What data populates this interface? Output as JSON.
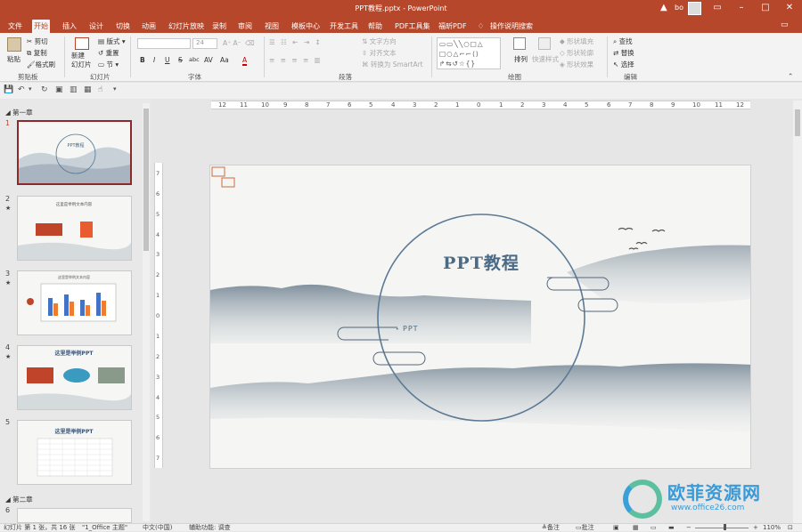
{
  "window": {
    "title": "PPT教程.pptx  -  PowerPoint",
    "user": "bo"
  },
  "tabs": [
    "文件",
    "开始",
    "插入",
    "设计",
    "切换",
    "动画",
    "幻灯片放映",
    "录制",
    "审阅",
    "视图",
    "模板中心",
    "开发工具",
    "帮助",
    "PDF工具集",
    "福昕PDF",
    "操作说明搜索"
  ],
  "active_tab": "开始",
  "ribbon": {
    "clipboard": {
      "paste": "粘贴",
      "cut": "剪切",
      "copy": "复制",
      "format_painter": "格式刷",
      "label": "剪贴板"
    },
    "slides": {
      "new_slide": "新建\n幻灯片",
      "layout": "版式",
      "reset": "重置",
      "section": "节",
      "label": "幻灯片"
    },
    "font": {
      "font_name": "",
      "font_size": "24",
      "label": "字体",
      "buttons": [
        "B",
        "I",
        "U",
        "S",
        "abc",
        "AV",
        "Aa",
        "A"
      ]
    },
    "paragraph": {
      "text_direction": "文字方向",
      "align_text": "对齐文本",
      "smartart": "转换为 SmartArt",
      "label": "段落"
    },
    "drawing": {
      "arrange": "排列",
      "quick_styles": "快速样式",
      "shape_fill": "形状填充",
      "shape_outline": "形状轮廓",
      "shape_effects": "形状效果",
      "label": "绘图"
    },
    "editing": {
      "find": "查找",
      "replace": "替换",
      "select": "选择",
      "label": "编辑"
    }
  },
  "sections": [
    "第一章",
    "第二章"
  ],
  "thumbnails": [
    {
      "num": "1",
      "title": "PPT教程"
    },
    {
      "num": "2",
      "title": "这里是举例文本内容"
    },
    {
      "num": "3",
      "title": "这里是举例文本内容"
    },
    {
      "num": "4",
      "title": "这里是举例PPT"
    },
    {
      "num": "5",
      "title": "这里是举例PPT"
    },
    {
      "num": "6",
      "title": ""
    }
  ],
  "ruler": {
    "h": [
      "12",
      "11",
      "10",
      "9",
      "8",
      "7",
      "6",
      "5",
      "4",
      "3",
      "2",
      "1",
      "0",
      "1",
      "2",
      "3",
      "4",
      "5",
      "6",
      "7",
      "8",
      "9",
      "10",
      "11",
      "12"
    ],
    "v": [
      "7",
      "6",
      "5",
      "4",
      "3",
      "2",
      "1",
      "0",
      "1",
      "2",
      "3",
      "4",
      "5",
      "6",
      "7"
    ]
  },
  "slide": {
    "title": "PPT教程",
    "bullet": "PPT"
  },
  "watermark": {
    "name": "欧菲资源网",
    "url": "www.office26.com"
  },
  "status": {
    "slide": "幻灯片 第 1 张，共 16 张",
    "theme": "\"1_Office 主题\"",
    "language": "中文(中国)",
    "accessibility": "辅助功能: 调查",
    "notes": "备注",
    "comments": "批注",
    "zoom": "110%"
  },
  "colors": {
    "accent": "#b7472a",
    "ink": "#4a6a85"
  }
}
